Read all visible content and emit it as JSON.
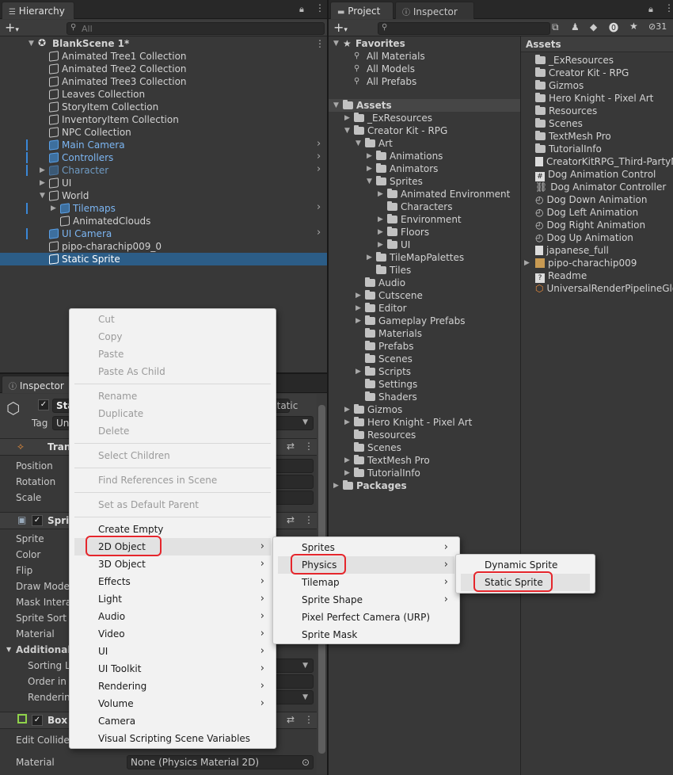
{
  "hierarchy": {
    "tab": "Hierarchy",
    "search_placeholder": "All",
    "scene": "BlankScene 1*",
    "items": [
      {
        "label": "Animated Tree1 Collection"
      },
      {
        "label": "Animated Tree2 Collection"
      },
      {
        "label": "Animated Tree3 Collection"
      },
      {
        "label": "Leaves Collection"
      },
      {
        "label": "StoryItem Collection"
      },
      {
        "label": "InventoryItem Collection"
      },
      {
        "label": "NPC Collection"
      },
      {
        "label": "Main Camera"
      },
      {
        "label": "Controllers"
      },
      {
        "label": "Character"
      },
      {
        "label": "UI"
      },
      {
        "label": "World"
      },
      {
        "label": "Tilemaps"
      },
      {
        "label": "AnimatedClouds"
      },
      {
        "label": "UI Camera"
      },
      {
        "label": "pipo-charachip009_0"
      },
      {
        "label": "Static Sprite"
      }
    ]
  },
  "inspector": {
    "tab": "Inspector",
    "name_partial": "Sta",
    "static_label": "Static",
    "tag_label": "Tag",
    "tag_value": "Un",
    "transform_title": "Tran",
    "position": "Position",
    "rotation": "Rotation",
    "scale": "Scale",
    "sprite_title": "Sprit",
    "sprite_rows": [
      "Sprite",
      "Color",
      "Flip",
      "Draw Mode",
      "Mask Intera",
      "Sprite Sort P",
      "Material"
    ],
    "additional": "Additional S",
    "sorting_rows": [
      "Sorting La",
      "Order in L",
      "Renderin"
    ],
    "box_title": "Box",
    "edit_collider": "Edit Collider",
    "material_label": "Material",
    "material_value": "None (Physics Material 2D)"
  },
  "project": {
    "tab_project": "Project",
    "tab_inspector": "Inspector",
    "badge_count": "31",
    "favorites": "Favorites",
    "fav_items": [
      "All Materials",
      "All Models",
      "All Prefabs"
    ],
    "assets_root": "Assets",
    "tree": [
      "_ExResources",
      "Creator Kit - RPG",
      "Art",
      "Animations",
      "Animators",
      "Sprites",
      "Animated Environment",
      "Characters",
      "Environment",
      "Floors",
      "UI",
      "TileMapPalettes",
      "Tiles",
      "Audio",
      "Cutscene",
      "Editor",
      "Gameplay Prefabs",
      "Materials",
      "Prefabs",
      "Scenes",
      "Scripts",
      "Settings",
      "Shaders",
      "Gizmos",
      "Hero Knight - Pixel Art",
      "Resources",
      "Scenes",
      "TextMesh Pro",
      "TutorialInfo"
    ],
    "packages": "Packages",
    "assets_header": "Assets",
    "assets_list": [
      "_ExResources",
      "Creator Kit - RPG",
      "Gizmos",
      "Hero Knight - Pixel Art",
      "Resources",
      "Scenes",
      "TextMesh Pro",
      "TutorialInfo",
      "CreatorKitRPG_Third-PartyN",
      "Dog Animation Control",
      "Dog Animator Controller",
      "Dog Down Animation",
      "Dog Left Animation",
      "Dog Right Animation",
      "Dog Up Animation",
      "japanese_full",
      "pipo-charachip009",
      "Readme",
      "UniversalRenderPipelineGlo"
    ]
  },
  "context_menu": {
    "items": [
      {
        "label": "Cut",
        "enabled": false
      },
      {
        "label": "Copy",
        "enabled": false
      },
      {
        "label": "Paste",
        "enabled": false
      },
      {
        "label": "Paste As Child",
        "enabled": false
      },
      {
        "label": "Rename",
        "enabled": false
      },
      {
        "label": "Duplicate",
        "enabled": false
      },
      {
        "label": "Delete",
        "enabled": false
      },
      {
        "label": "Select Children",
        "enabled": false
      },
      {
        "label": "Find References in Scene",
        "enabled": false
      },
      {
        "label": "Set as Default Parent",
        "enabled": false
      },
      {
        "label": "Create Empty",
        "enabled": true
      },
      {
        "label": "2D Object",
        "enabled": true
      },
      {
        "label": "3D Object",
        "enabled": true
      },
      {
        "label": "Effects",
        "enabled": true
      },
      {
        "label": "Light",
        "enabled": true
      },
      {
        "label": "Audio",
        "enabled": true
      },
      {
        "label": "Video",
        "enabled": true
      },
      {
        "label": "UI",
        "enabled": true
      },
      {
        "label": "UI Toolkit",
        "enabled": true
      },
      {
        "label": "Rendering",
        "enabled": true
      },
      {
        "label": "Volume",
        "enabled": true
      },
      {
        "label": "Camera",
        "enabled": true
      },
      {
        "label": "Visual Scripting Scene Variables",
        "enabled": true
      }
    ]
  },
  "submenu_2d": {
    "items": [
      "Sprites",
      "Physics",
      "Tilemap",
      "Sprite Shape",
      "Pixel Perfect Camera (URP)",
      "Sprite Mask"
    ]
  },
  "submenu_physics": {
    "items": [
      "Dynamic Sprite",
      "Static Sprite"
    ]
  },
  "colors": {
    "selection": "#2c5d87",
    "highlight_box": "#e5262c",
    "menu_bg": "#f2f2f2"
  }
}
